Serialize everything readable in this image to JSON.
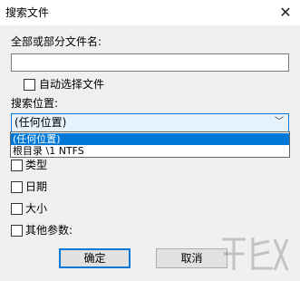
{
  "dialog": {
    "title": "搜索文件",
    "close_glyph": "✕"
  },
  "filename": {
    "label": "全部或部分文件名:",
    "value": ""
  },
  "auto_select": {
    "label": "自动选择文件",
    "checked": false
  },
  "search_location": {
    "label": "搜索位置:",
    "selected": "(任何位置)",
    "arrow_glyph": "﹀",
    "options": [
      "(任何位置)",
      "根目录 \\1 NTFS"
    ]
  },
  "filters": [
    {
      "label": "类型",
      "checked": false
    },
    {
      "label": "日期",
      "checked": false
    },
    {
      "label": "大小",
      "checked": false
    },
    {
      "label": "其他参数:",
      "checked": false
    }
  ],
  "buttons": {
    "ok": "确定",
    "cancel": "取消"
  },
  "icons": {
    "close": "close-icon",
    "dropdown": "chevron-down-icon"
  },
  "colors": {
    "accent": "#0078d7",
    "combo_bg": "#e5f1fb",
    "dialog_bg": "#f0f0f0"
  }
}
